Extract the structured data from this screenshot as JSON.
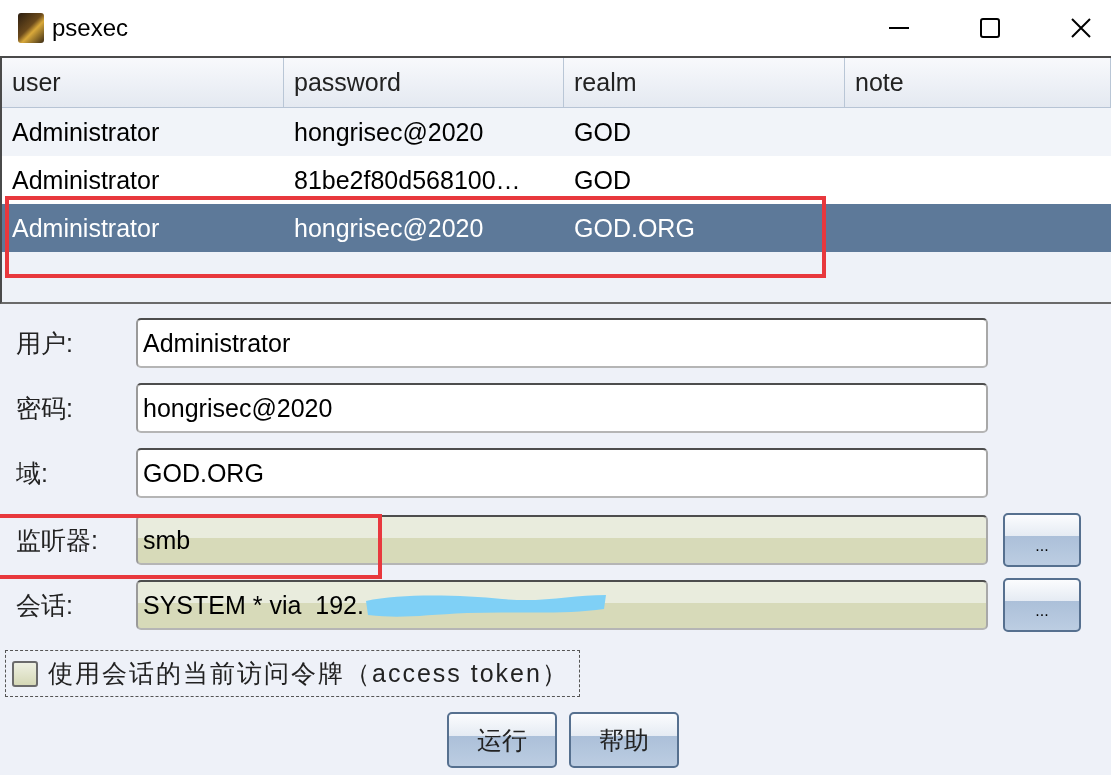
{
  "window": {
    "title": "psexec"
  },
  "table": {
    "columns": [
      "user",
      "password",
      "realm",
      "note"
    ],
    "rows": [
      {
        "cells": [
          "Administrator",
          "hongrisec@2020",
          "GOD"
        ],
        "selected": false,
        "highlighted": false
      },
      {
        "cells": [
          "Administrator",
          "81be2f80d568100…",
          "GOD"
        ],
        "selected": false,
        "highlighted": false
      },
      {
        "cells": [
          "Administrator",
          "hongrisec@2020",
          "GOD.ORG"
        ],
        "selected": true,
        "highlighted": true
      }
    ]
  },
  "form": {
    "fields": [
      {
        "label": "用户:",
        "value": "Administrator",
        "kind": "text",
        "highlighted": false,
        "redacted": false
      },
      {
        "label": "密码:",
        "value": "hongrisec@2020",
        "kind": "text",
        "highlighted": false,
        "redacted": false
      },
      {
        "label": "域:",
        "value": "GOD.ORG",
        "kind": "text",
        "highlighted": false,
        "redacted": false
      },
      {
        "label": "监听器:",
        "value": "smb",
        "kind": "picker",
        "button": "...",
        "highlighted": true,
        "redacted": false
      },
      {
        "label": "会话:",
        "value": "SYSTEM * via  192.",
        "kind": "picker",
        "button": "...",
        "highlighted": false,
        "redacted": true
      }
    ]
  },
  "checkbox": {
    "label": "使用会话的当前访问令牌（access token）",
    "checked": false,
    "focused": true
  },
  "buttons": [
    "运行",
    "帮助"
  ]
}
